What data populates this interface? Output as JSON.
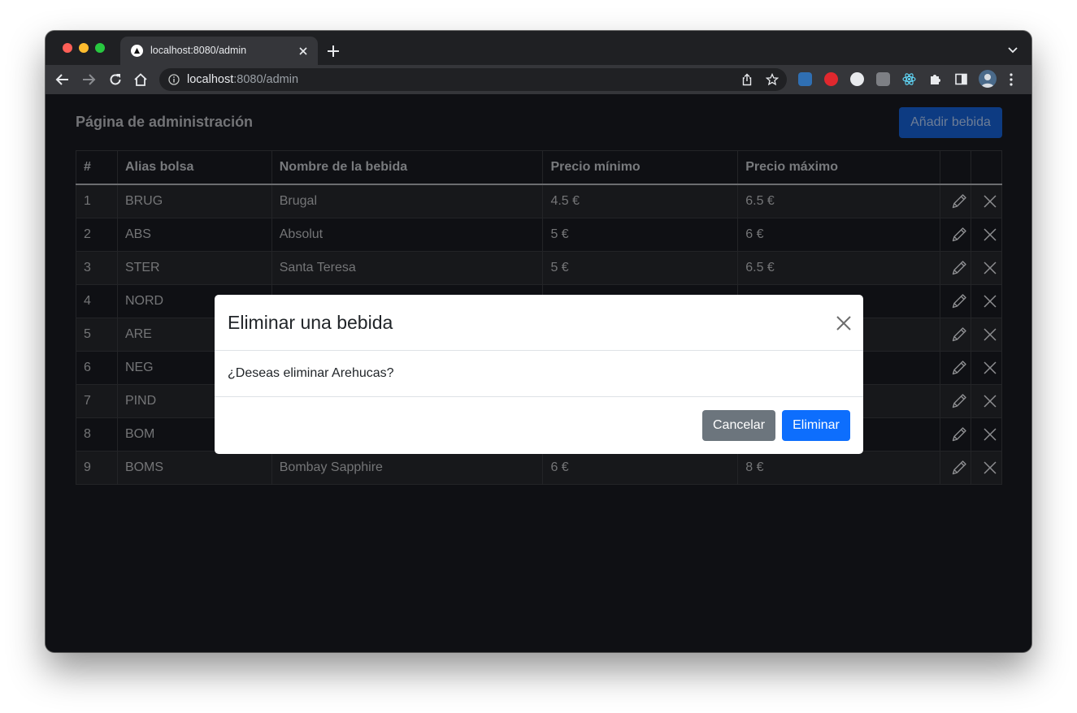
{
  "browser": {
    "tab_title": "localhost:8080/admin",
    "url_host": "localhost",
    "url_rest": ":8080/admin"
  },
  "page": {
    "title": "Página de administración",
    "add_button": "Añadir bebida"
  },
  "table": {
    "headers": [
      "#",
      "Alias bolsa",
      "Nombre de la bebida",
      "Precio mínimo",
      "Precio máximo"
    ],
    "rows": [
      [
        "1",
        "BRUG",
        "Brugal",
        "4.5 €",
        "6.5 €"
      ],
      [
        "2",
        "ABS",
        "Absolut",
        "5 €",
        "6 €"
      ],
      [
        "3",
        "STER",
        "Santa Teresa",
        "5 €",
        "6.5 €"
      ],
      [
        "4",
        "NORD",
        "",
        "",
        ""
      ],
      [
        "5",
        "ARE",
        "",
        "",
        ""
      ],
      [
        "6",
        "NEG",
        "",
        "",
        ""
      ],
      [
        "7",
        "PIND",
        "",
        "",
        ""
      ],
      [
        "8",
        "BOM",
        "",
        "",
        ""
      ],
      [
        "9",
        "BOMS",
        "Bombay Sapphire",
        "6 €",
        "8 €"
      ]
    ]
  },
  "modal": {
    "title": "Eliminar una bebida",
    "message": "¿Deseas eliminar Arehucas?",
    "cancel_label": "Cancelar",
    "delete_label": "Eliminar"
  },
  "colors": {
    "primary": "#0d6efd",
    "secondary": "#6c757d",
    "page_bg": "#0f1014"
  }
}
